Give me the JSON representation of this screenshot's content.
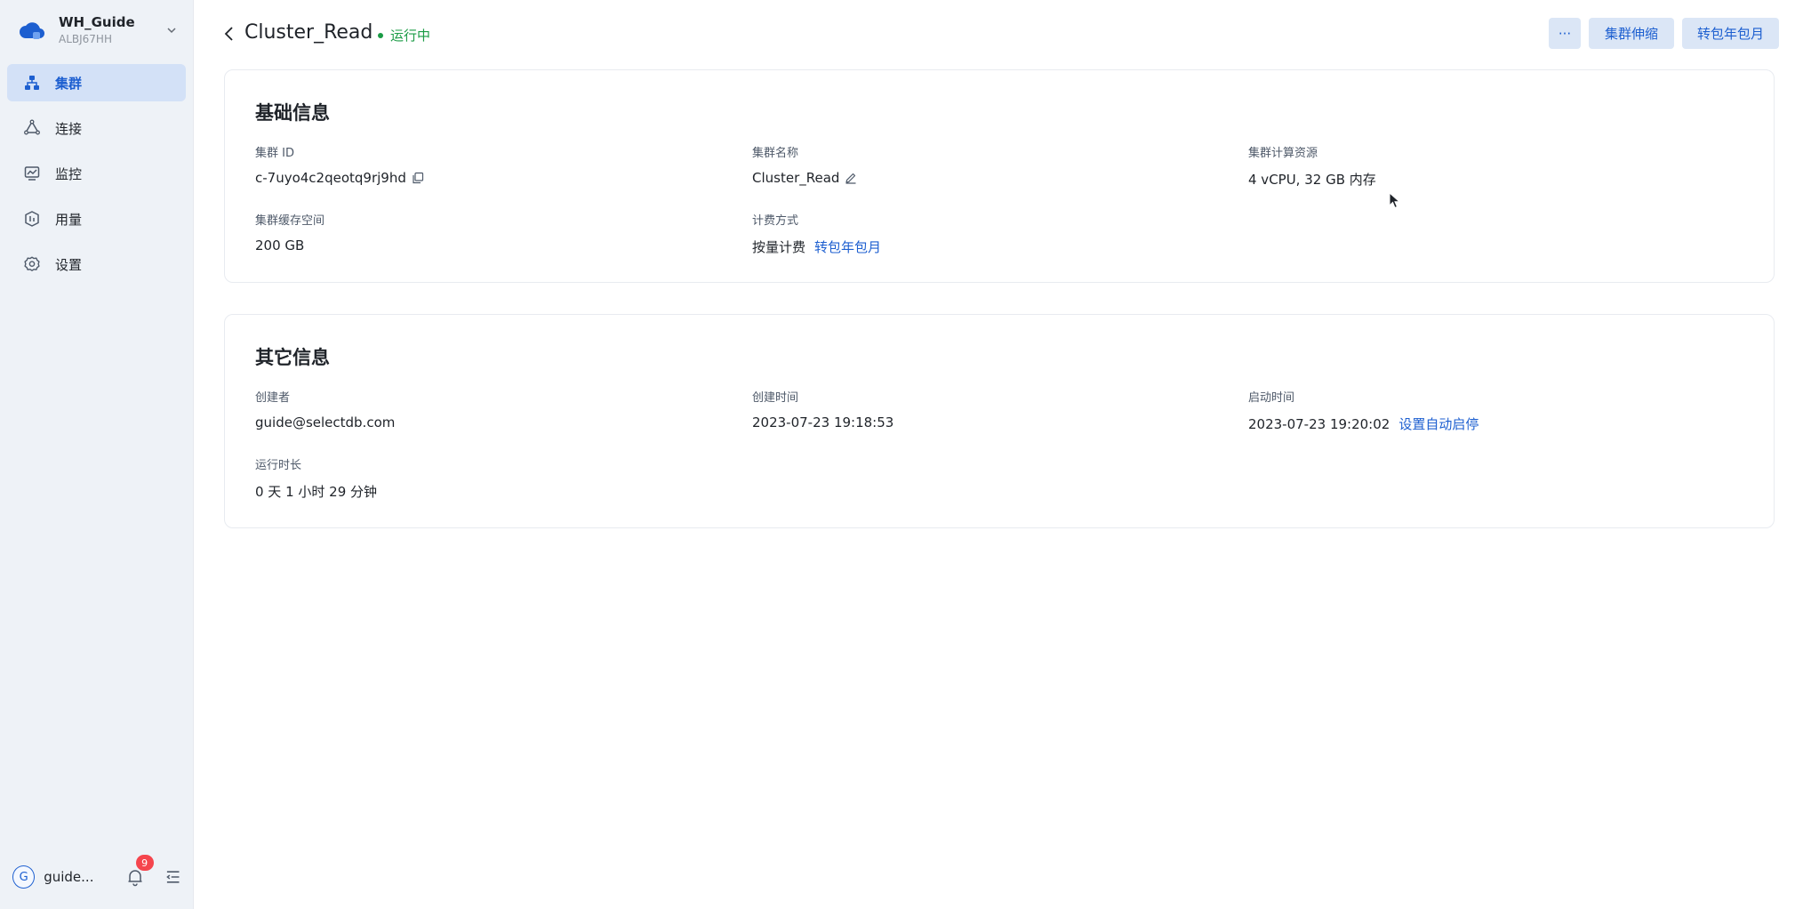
{
  "workspace": {
    "name": "WH_Guide",
    "code": "ALBJ67HH"
  },
  "sidebar": {
    "items": [
      {
        "label": "集群",
        "icon": "cluster-icon",
        "active": true
      },
      {
        "label": "连接",
        "icon": "connect-icon",
        "active": false
      },
      {
        "label": "监控",
        "icon": "monitor-icon",
        "active": false
      },
      {
        "label": "用量",
        "icon": "usage-icon",
        "active": false
      },
      {
        "label": "设置",
        "icon": "gear-icon",
        "active": false
      }
    ]
  },
  "footer": {
    "avatar_letter": "G",
    "user_name": "guide...",
    "notification_count": "9"
  },
  "header": {
    "title": "Cluster_Read",
    "status": "运行中",
    "more_label": "···",
    "scale_label": "集群伸缩",
    "convert_label": "转包年包月"
  },
  "basic_info": {
    "title": "基础信息",
    "cluster_id_label": "集群 ID",
    "cluster_id": "c-7uyo4c2qeotq9rj9hd",
    "cluster_name_label": "集群名称",
    "cluster_name": "Cluster_Read",
    "compute_label": "集群计算资源",
    "compute": "4 vCPU, 32 GB 内存",
    "cache_label": "集群缓存空间",
    "cache": "200 GB",
    "billing_label": "计费方式",
    "billing": "按量计费",
    "billing_link": "转包年包月"
  },
  "other_info": {
    "title": "其它信息",
    "creator_label": "创建者",
    "creator": "guide@selectdb.com",
    "created_label": "创建时间",
    "created": "2023-07-23 19:18:53",
    "started_label": "启动时间",
    "started": "2023-07-23 19:20:02",
    "auto_link": "设置自动启停",
    "runtime_label": "运行时长",
    "runtime": "0 天 1 小时 29 分钟"
  },
  "colors": {
    "accent": "#1d5fd0",
    "status_green": "#1a9b45",
    "badge_red": "#f5454d",
    "sidebar_bg": "#eef2f7"
  }
}
